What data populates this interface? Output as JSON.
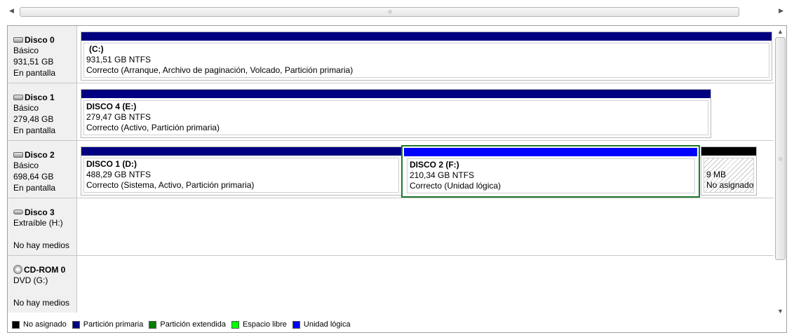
{
  "colors": {
    "primary": "#000080",
    "logical": "#0000ff",
    "extended": "#008000",
    "free": "#00ff00",
    "unallocated": "#000000"
  },
  "disks": [
    {
      "name": "Disco 0",
      "icon": "hard-disk-icon",
      "type": "Básico",
      "size": "931,51 GB",
      "status": "En pantalla",
      "partitions": [
        {
          "title": "(C:)",
          "size": "931,51 GB NTFS",
          "status": "Correcto (Arranque, Archivo de paginación, Volcado, Partición primaria)"
        }
      ]
    },
    {
      "name": "Disco 1",
      "icon": "hard-disk-icon",
      "type": "Básico",
      "size": "279,48 GB",
      "status": "En pantalla",
      "partitions": [
        {
          "title": "DISCO 4  (E:)",
          "size": "279,47 GB NTFS",
          "status": "Correcto (Activo, Partición primaria)"
        }
      ]
    },
    {
      "name": "Disco 2",
      "icon": "hard-disk-icon",
      "type": "Básico",
      "size": "698,64 GB",
      "status": "En pantalla",
      "partitions": [
        {
          "title": "DISCO 1  (D:)",
          "size": "488,29 GB NTFS",
          "status": "Correcto (Sistema, Activo, Partición primaria)"
        },
        {
          "title": "DISCO 2  (F:)",
          "size": "210,34 GB NTFS",
          "status": "Correcto (Unidad lógica)"
        },
        {
          "size": "9 MB",
          "status": "No asignado"
        }
      ]
    },
    {
      "name": "Disco 3",
      "icon": "removable-disk-icon",
      "type": "Extraíble (H:)",
      "status": "No hay medios"
    },
    {
      "name": "CD-ROM 0",
      "icon": "cdrom-icon",
      "type": "DVD (G:)",
      "status": "No hay medios"
    }
  ],
  "legend": [
    {
      "label": "No asignado",
      "color": "#000000"
    },
    {
      "label": "Partición primaria",
      "color": "#000080"
    },
    {
      "label": "Partición extendida",
      "color": "#008000"
    },
    {
      "label": "Espacio libre",
      "color": "#00ff00"
    },
    {
      "label": "Unidad lógica",
      "color": "#0000ff"
    }
  ]
}
